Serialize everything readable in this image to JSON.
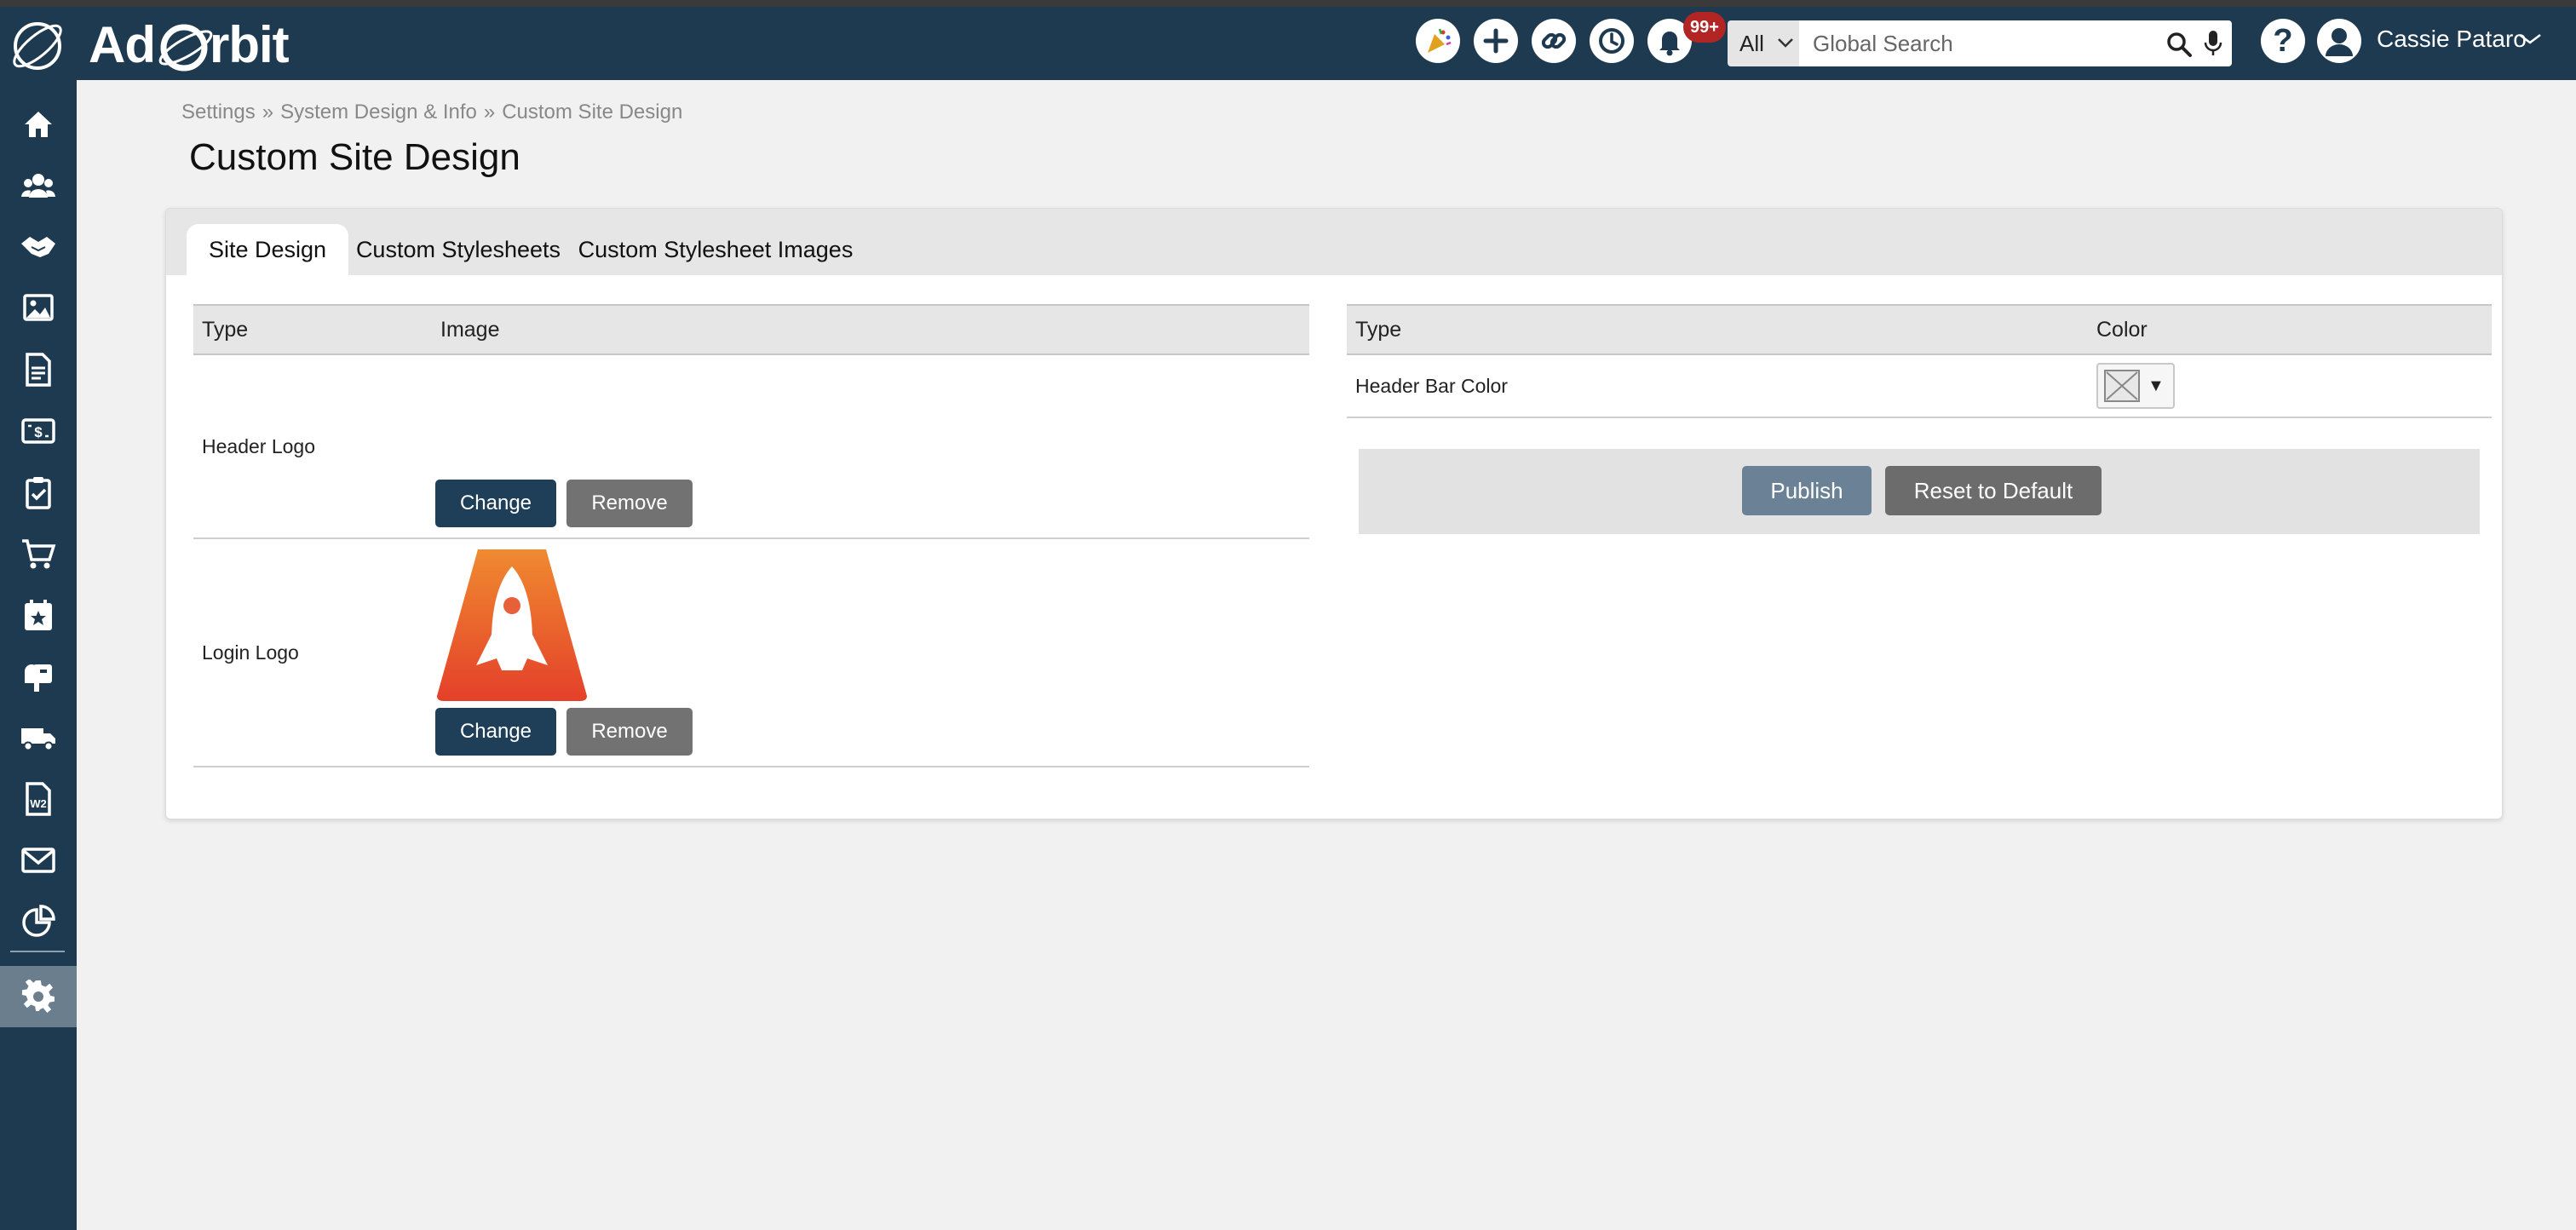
{
  "app": {
    "brand": "Ad Orbit",
    "brand_prefix": "Ad",
    "brand_suffix": "rbit",
    "accent_color": "#1e3a50"
  },
  "header": {
    "notification_badge": "99+",
    "search": {
      "scope": "All",
      "placeholder": "Global Search"
    },
    "help_label": "?",
    "user_name": "Cassie Pataro",
    "icons": [
      "party-icon",
      "plus-icon",
      "link-icon",
      "history-icon",
      "bell-icon"
    ]
  },
  "sidebar": {
    "items": [
      "home-icon",
      "contacts-icon",
      "deals-icon",
      "gallery-icon",
      "reports-icon",
      "billing-icon",
      "tasks-icon",
      "orders-icon",
      "events-icon",
      "mailbox-icon",
      "delivery-icon",
      "w2-icon",
      "email-icon",
      "analytics-icon"
    ],
    "active": "settings-icon"
  },
  "breadcrumb": {
    "items": [
      "Settings",
      "System Design & Info",
      "Custom Site Design"
    ],
    "separator": "»"
  },
  "page_title": "Custom Site Design",
  "tabs": [
    {
      "label": "Site Design",
      "active": true
    },
    {
      "label": "Custom Stylesheets",
      "active": false
    },
    {
      "label": "Custom Stylesheet Images",
      "active": false
    }
  ],
  "images_table": {
    "headers": [
      "Type",
      "Image"
    ],
    "rows": [
      {
        "type": "Header Logo",
        "has_image": false
      },
      {
        "type": "Login Logo",
        "has_image": true
      }
    ],
    "change_label": "Change",
    "remove_label": "Remove"
  },
  "colors_table": {
    "headers": [
      "Type",
      "Color"
    ],
    "rows": [
      {
        "type": "Header Bar Color",
        "swatch_arrow": "▼"
      }
    ]
  },
  "actions": {
    "publish_label": "Publish",
    "reset_label": "Reset to Default"
  }
}
